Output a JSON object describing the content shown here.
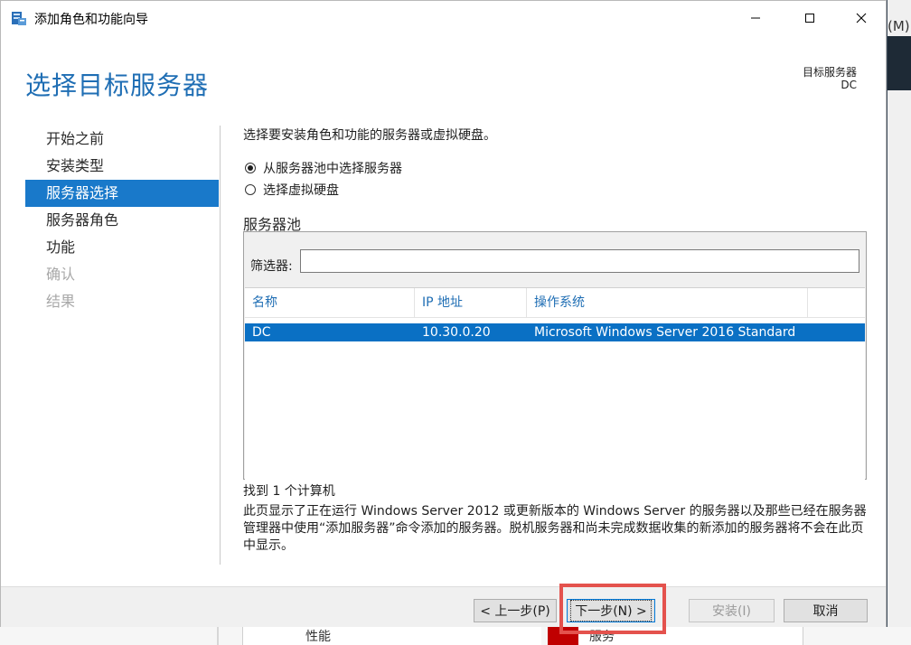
{
  "window": {
    "title": "添加角色和功能向导",
    "minimize_icon": "minimize-icon",
    "maximize_icon": "maximize-icon",
    "close_icon": "close-icon"
  },
  "header": {
    "page_title": "选择目标服务器",
    "dest_label": "目标服务器",
    "dest_value": "DC"
  },
  "nav": {
    "items": [
      {
        "label": "开始之前",
        "state": "normal"
      },
      {
        "label": "安装类型",
        "state": "normal"
      },
      {
        "label": "服务器选择",
        "state": "active"
      },
      {
        "label": "服务器角色",
        "state": "normal"
      },
      {
        "label": "功能",
        "state": "normal"
      },
      {
        "label": "确认",
        "state": "disabled"
      },
      {
        "label": "结果",
        "state": "disabled"
      }
    ]
  },
  "content": {
    "instruction": "选择要安装角色和功能的服务器或虚拟硬盘。",
    "radio_pool": "从服务器池中选择服务器",
    "radio_vhd": "选择虚拟硬盘",
    "selected_option": "pool",
    "pool_title": "服务器池",
    "filter_label": "筛选器:",
    "filter_value": "",
    "columns": [
      "名称",
      "IP 地址",
      "操作系统"
    ],
    "rows": [
      {
        "name": "DC",
        "ip": "10.30.0.20",
        "os": "Microsoft Windows Server 2016 Standard"
      }
    ],
    "found": "找到 1 个计算机",
    "description": "此页显示了正在运行 Windows Server 2012 或更新版本的 Windows Server 的服务器以及那些已经在服务器管理器中使用“添加服务器”命令添加的服务器。脱机服务器和尚未完成数据收集的新添加的服务器将不会在此页中显示。"
  },
  "footer": {
    "prev": "< 上一步(P)",
    "next": "下一步(N) >",
    "install": "安装(I)",
    "cancel": "取消"
  },
  "background": {
    "right_letter": "(M)",
    "bottom_left": "性能",
    "bottom_right": "服务"
  },
  "colors": {
    "accent": "#1979ca",
    "title_blue": "#1f6eb4",
    "highlight": "#e4524d"
  }
}
